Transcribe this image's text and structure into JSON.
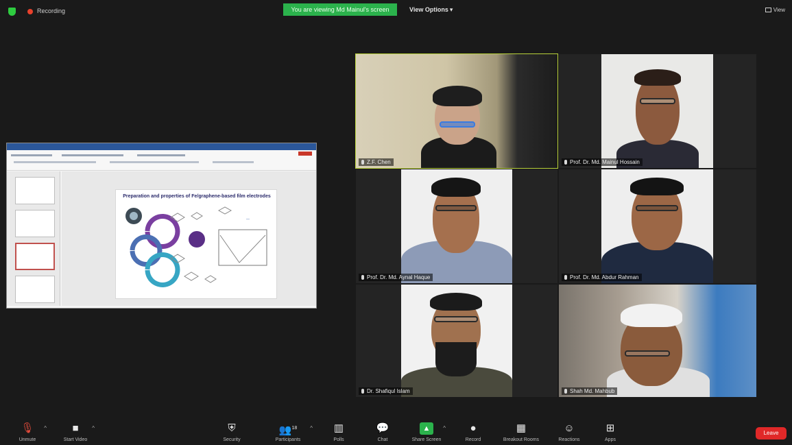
{
  "topbar": {
    "recording_label": "Recording",
    "share_banner": "You are viewing Md Mainul's screen",
    "view_options_label": "View Options",
    "view_mode_label": "View"
  },
  "shared_screen": {
    "slide_title": "Preparation and properties of Fe/graphene-based film electrodes"
  },
  "participants": [
    {
      "name": "Z.F. Chen",
      "active": true
    },
    {
      "name": "Prof. Dr. Md. Mainul Hossain"
    },
    {
      "name": "Prof. Dr. Md. Aynal Haque"
    },
    {
      "name": "Prof. Dr. Md. Abdur Rahman"
    },
    {
      "name": "Dr. Shafiqul Islam"
    },
    {
      "name": "Shah Md. Mahbub"
    }
  ],
  "toolbar": {
    "unmute": "Unmute",
    "start_video": "Start Video",
    "security": "Security",
    "participants": "Participants",
    "participants_count": "18",
    "polls": "Polls",
    "chat": "Chat",
    "share_screen": "Share Screen",
    "record": "Record",
    "breakout_rooms": "Breakout Rooms",
    "reactions": "Reactions",
    "apps": "Apps",
    "leave": "Leave"
  },
  "colors": {
    "share_green": "#2bb24c",
    "active_speaker": "#b9d23a",
    "leave_red": "#e02828"
  }
}
